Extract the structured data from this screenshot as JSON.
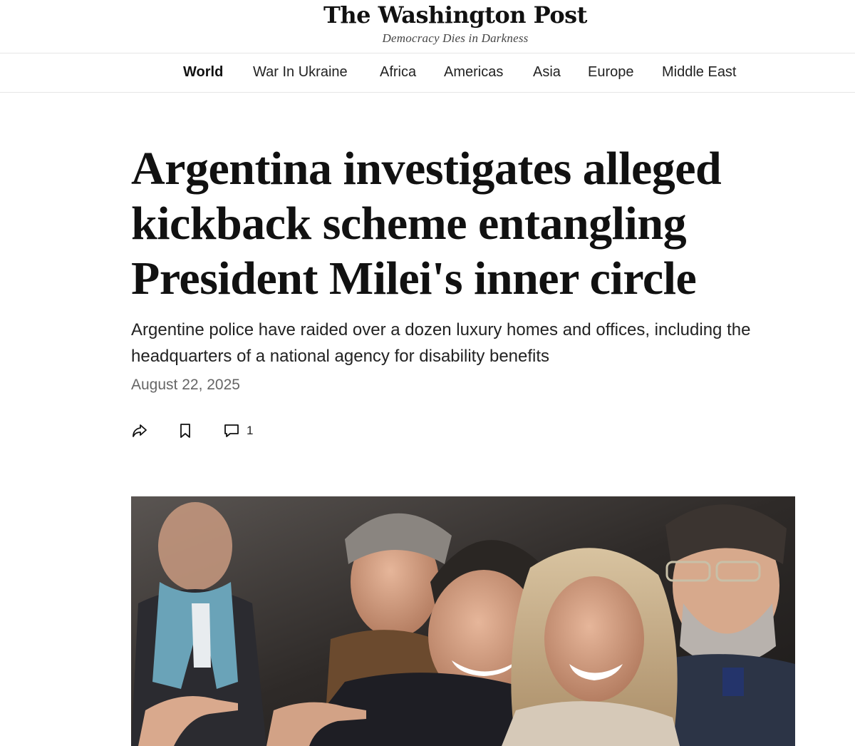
{
  "masthead": {
    "logo": "The Washington Post",
    "tagline": "Democracy Dies in Darkness"
  },
  "nav": {
    "items": [
      {
        "label": "World",
        "active": true
      },
      {
        "label": "War In Ukraine",
        "active": false
      },
      {
        "label": "Africa",
        "active": false
      },
      {
        "label": "Americas",
        "active": false
      },
      {
        "label": "Asia",
        "active": false
      },
      {
        "label": "Europe",
        "active": false
      },
      {
        "label": "Middle East",
        "active": false
      }
    ]
  },
  "article": {
    "headline": "Argentina investigates alleged kickback scheme entangling President Milei's inner circle",
    "dek": "Argentine police have raided over a dozen luxury homes and offices, including the headquarters of a national agency for disability benefits",
    "date": "August 22, 2025"
  },
  "actions": {
    "share_icon": "share-icon",
    "bookmark_icon": "bookmark-icon",
    "comment_icon": "comment-icon",
    "comment_count": "1"
  }
}
